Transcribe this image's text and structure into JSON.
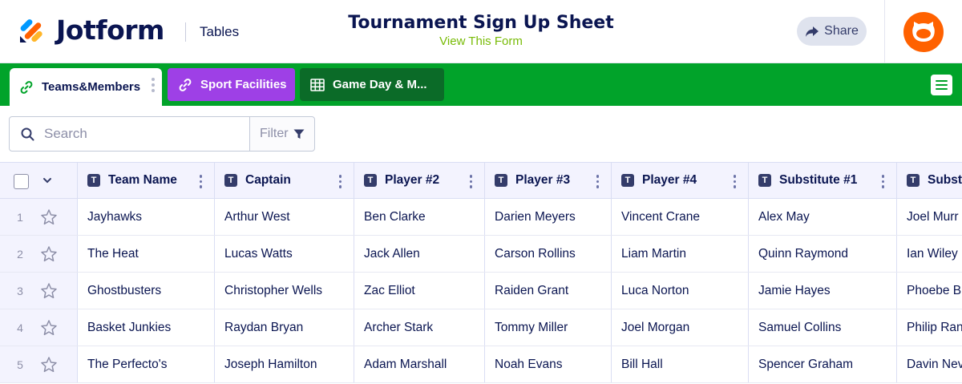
{
  "header": {
    "brand": "Jotform",
    "section": "Tables",
    "form_title": "Tournament Sign Up Sheet",
    "form_link": "View This Form",
    "share_label": "Share"
  },
  "colors": {
    "brand_green": "#01a32a",
    "tab_purple": "#9e40e6",
    "tab_dark_green": "#0b6b28",
    "navy": "#0a1551",
    "avatar_orange": "#ff6100",
    "link_green": "#78bb07"
  },
  "tabs": [
    {
      "label": "Teams&Members",
      "icon": "link-icon",
      "active": true
    },
    {
      "label": "Sport Facilities",
      "icon": "link-icon",
      "active": false
    },
    {
      "label": "Game Day & M...",
      "icon": "table-icon",
      "active": false
    }
  ],
  "toolbar": {
    "search_placeholder": "Search",
    "filter_label": "Filter"
  },
  "table": {
    "columns": [
      "Team Name",
      "Captain",
      "Player #2",
      "Player #3",
      "Player #4",
      "Substitute #1",
      "Subst"
    ],
    "rows": [
      {
        "num": "1",
        "cells": [
          "Jayhawks",
          "Arthur West",
          "Ben Clarke",
          "Darien Meyers",
          "Vincent Crane",
          "Alex May",
          "Joel Murr"
        ]
      },
      {
        "num": "2",
        "cells": [
          "The Heat",
          "Lucas Watts",
          "Jack Allen",
          "Carson Rollins",
          "Liam Martin",
          "Quinn Raymond",
          "Ian Wiley"
        ]
      },
      {
        "num": "3",
        "cells": [
          "Ghostbusters",
          "Christopher Wells",
          "Zac Elliot",
          "Raiden Grant",
          "Luca Norton",
          "Jamie Hayes",
          "Phoebe B"
        ]
      },
      {
        "num": "4",
        "cells": [
          "Basket Junkies",
          "Raydan Bryan",
          "Archer Stark",
          "Tommy Miller",
          "Joel Morgan",
          "Samuel Collins",
          "Philip Ran"
        ]
      },
      {
        "num": "5",
        "cells": [
          "The Perfecto's",
          "Joseph Hamilton",
          "Adam Marshall",
          "Noah Evans",
          "Bill Hall",
          "Spencer Graham",
          "Davin Nev"
        ]
      }
    ]
  }
}
